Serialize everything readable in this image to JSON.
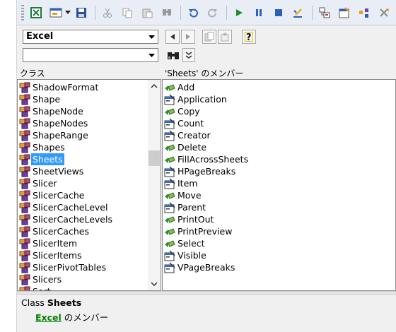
{
  "toolbar": {
    "buttons": [
      "excel-icon",
      "view-object-icon",
      "dropdown-arrow-icon",
      "save-icon",
      "cut-icon",
      "copy-icon",
      "paste-icon",
      "find-icon",
      "undo-icon",
      "redo-icon",
      "run-icon",
      "break-icon",
      "reset-icon",
      "design-mode-icon",
      "project-explorer-icon",
      "properties-icon",
      "object-browser-icon",
      "toolbox-icon"
    ]
  },
  "browser": {
    "library_value": "Excel",
    "search_value": "",
    "classes_header": "クラス",
    "members_header": "'Sheets' のメンバー",
    "classes": [
      "ShadowFormat",
      "Shape",
      "ShapeNode",
      "ShapeNodes",
      "ShapeRange",
      "Shapes",
      "Sheets",
      "SheetViews",
      "Slicer",
      "SlicerCache",
      "SlicerCacheLevel",
      "SlicerCacheLevels",
      "SlicerCaches",
      "SlicerItem",
      "SlicerItems",
      "SlicerPivotTables",
      "Slicers",
      "Sort"
    ],
    "selected_class": "Sheets",
    "members": [
      {
        "name": "Add",
        "kind": "method"
      },
      {
        "name": "Application",
        "kind": "property"
      },
      {
        "name": "Copy",
        "kind": "method"
      },
      {
        "name": "Count",
        "kind": "property"
      },
      {
        "name": "Creator",
        "kind": "property"
      },
      {
        "name": "Delete",
        "kind": "method"
      },
      {
        "name": "FillAcrossSheets",
        "kind": "method"
      },
      {
        "name": "HPageBreaks",
        "kind": "property"
      },
      {
        "name": "Item",
        "kind": "property"
      },
      {
        "name": "Move",
        "kind": "method"
      },
      {
        "name": "Parent",
        "kind": "property"
      },
      {
        "name": "PrintOut",
        "kind": "method"
      },
      {
        "name": "PrintPreview",
        "kind": "method"
      },
      {
        "name": "Select",
        "kind": "method"
      },
      {
        "name": "Visible",
        "kind": "property"
      },
      {
        "name": "VPageBreaks",
        "kind": "property"
      }
    ]
  },
  "details": {
    "class_prefix": "Class ",
    "class_name": "Sheets",
    "library_link": "Excel",
    "member_suffix": " のメンバー"
  },
  "colors": {
    "selection": "#3399ff",
    "link": "#008000"
  }
}
